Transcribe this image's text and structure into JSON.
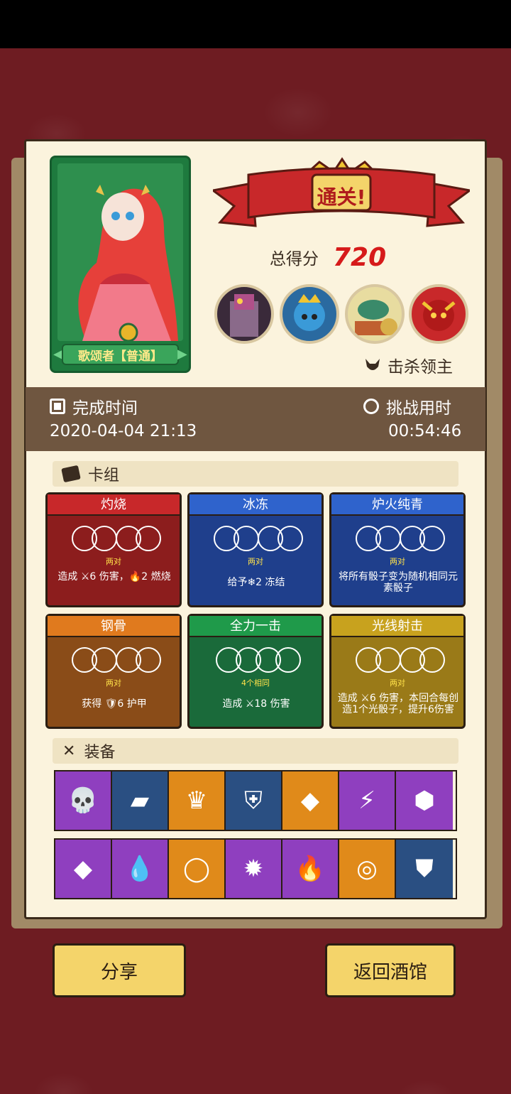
{
  "character": {
    "name": "歌颂者【普通】"
  },
  "result": {
    "title": "通关!",
    "score_label": "总得分",
    "score_value": "720"
  },
  "bosses": [
    "purple-tower-boss",
    "skull-king-boss",
    "fish-warrior-boss",
    "red-demon-boss"
  ],
  "kills_label": "击杀领主",
  "time": {
    "complete_label": "完成时间",
    "complete_value": "2020-04-04 21:13",
    "challenge_label": "挑战用时",
    "challenge_value": "00:54:46"
  },
  "deck": {
    "header": "卡组",
    "cards": [
      {
        "title": "灼烧",
        "combo": "两对",
        "effect": "造成 ⚔6 伤害，🔥2 燃烧",
        "color": "#8c1d1d",
        "title_color": "#c8282a",
        "dice": [
          2,
          2
        ]
      },
      {
        "title": "冰冻",
        "combo": "两对",
        "effect": "给予❄2 冻结",
        "color": "#1f3f8c",
        "title_color": "#2f63cc",
        "dice": [
          2,
          2
        ]
      },
      {
        "title": "炉火纯青",
        "combo": "两对",
        "effect": "将所有骰子变为随机相同元素骰子",
        "color": "#1f3f8c",
        "title_color": "#2f63cc",
        "dice": [
          2,
          2
        ]
      },
      {
        "title": "钢骨",
        "combo": "两对",
        "effect": "获得 🛡6 护甲",
        "color": "#8a4c18",
        "title_color": "#e07a1e",
        "dice": [
          2,
          2
        ]
      },
      {
        "title": "全力一击",
        "combo": "4个相同",
        "effect": "造成 ⚔18 伤害",
        "color": "#1a6a3a",
        "title_color": "#1f9a4a",
        "dice": [
          4
        ]
      },
      {
        "title": "光线射击",
        "combo": "两对",
        "effect": "造成 ⚔6 伤害，本回合每创造1个光骰子，提升6伤害",
        "color": "#9a7a18",
        "title_color": "#c8a21e",
        "dice": [
          2,
          2
        ]
      }
    ]
  },
  "equipment": {
    "header": "装备",
    "row1": [
      {
        "icon": "skull-icon",
        "bg": "purple",
        "glyph": "💀"
      },
      {
        "icon": "gold-bars-icon",
        "bg": "blue",
        "glyph": "▰"
      },
      {
        "icon": "spiked-armor-icon",
        "bg": "orange",
        "glyph": "♛"
      },
      {
        "icon": "shield-gem-icon",
        "bg": "blue",
        "glyph": "⛨"
      },
      {
        "icon": "ice-crystal-icon",
        "bg": "orange",
        "glyph": "◆"
      },
      {
        "icon": "lightning-ring-icon",
        "bg": "purple",
        "glyph": "⚡"
      },
      {
        "icon": "emerald-icon",
        "bg": "purple",
        "glyph": "⬢"
      }
    ],
    "row2": [
      {
        "icon": "ruby-icon",
        "bg": "purple",
        "glyph": "◆"
      },
      {
        "icon": "water-drop-icon",
        "bg": "purple",
        "glyph": "💧"
      },
      {
        "icon": "fire-ring-icon",
        "bg": "orange",
        "glyph": "◯"
      },
      {
        "icon": "sun-medallion-icon",
        "bg": "purple",
        "glyph": "✹"
      },
      {
        "icon": "flame-icon",
        "bg": "purple",
        "glyph": "🔥"
      },
      {
        "icon": "rainbow-swirl-icon",
        "bg": "orange",
        "glyph": "◎"
      },
      {
        "icon": "crest-shield-icon",
        "bg": "blue",
        "glyph": "⛊"
      }
    ]
  },
  "buttons": {
    "share": "分享",
    "return": "返回酒馆"
  }
}
